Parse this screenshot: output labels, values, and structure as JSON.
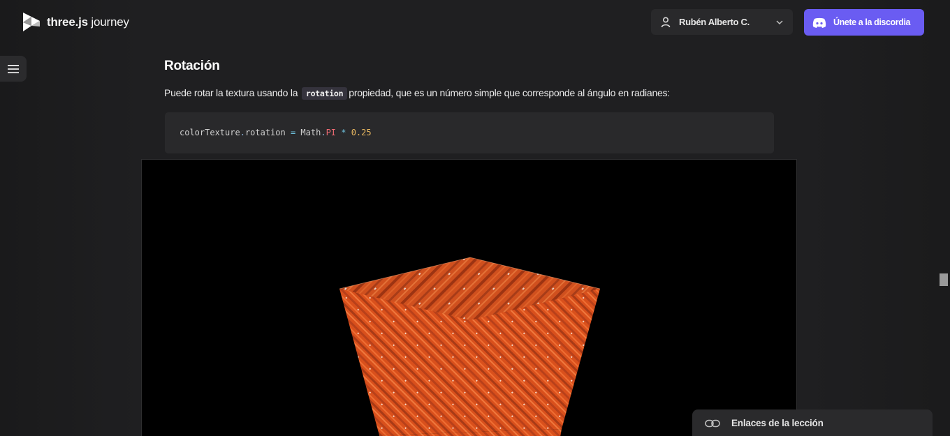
{
  "header": {
    "logo": {
      "brand": "three.js",
      "suffix": "journey",
      "icon": "threejs-journey-logo-icon"
    },
    "user_menu": {
      "name": "Rubén Alberto C.",
      "icon": "user-icon",
      "chevron": "chevron-down-icon"
    },
    "discord_button": {
      "label": "Únete a la discordia",
      "icon": "discord-icon",
      "color": "#6a5cf2"
    }
  },
  "sidebar_toggle": {
    "icon": "hamburger-menu-icon"
  },
  "content": {
    "heading": "Rotación",
    "paragraph": {
      "before": "Puede rotar la textura usando la",
      "code": "rotation",
      "after": "propiedad, que es un número simple que corresponde al ángulo en radianes:"
    },
    "code_block": {
      "tokens": [
        {
          "text": "colorTexture",
          "kind": "plain"
        },
        {
          "text": ".",
          "kind": "punc"
        },
        {
          "text": "rotation",
          "kind": "plain"
        },
        {
          "text": " = ",
          "kind": "op"
        },
        {
          "text": "Math",
          "kind": "plain"
        },
        {
          "text": ".",
          "kind": "punc"
        },
        {
          "text": "PI",
          "kind": "const"
        },
        {
          "text": " * ",
          "kind": "op"
        },
        {
          "text": "0.25",
          "kind": "num"
        }
      ]
    },
    "viewport": {
      "description_color": "#e0541f"
    }
  },
  "lesson_links": {
    "label": "Enlaces de la lección",
    "icon": "link-icon"
  },
  "colors": {
    "background": "#1f1f21",
    "accent": "#6a5cf2",
    "cube_orange": "#e0541f"
  }
}
